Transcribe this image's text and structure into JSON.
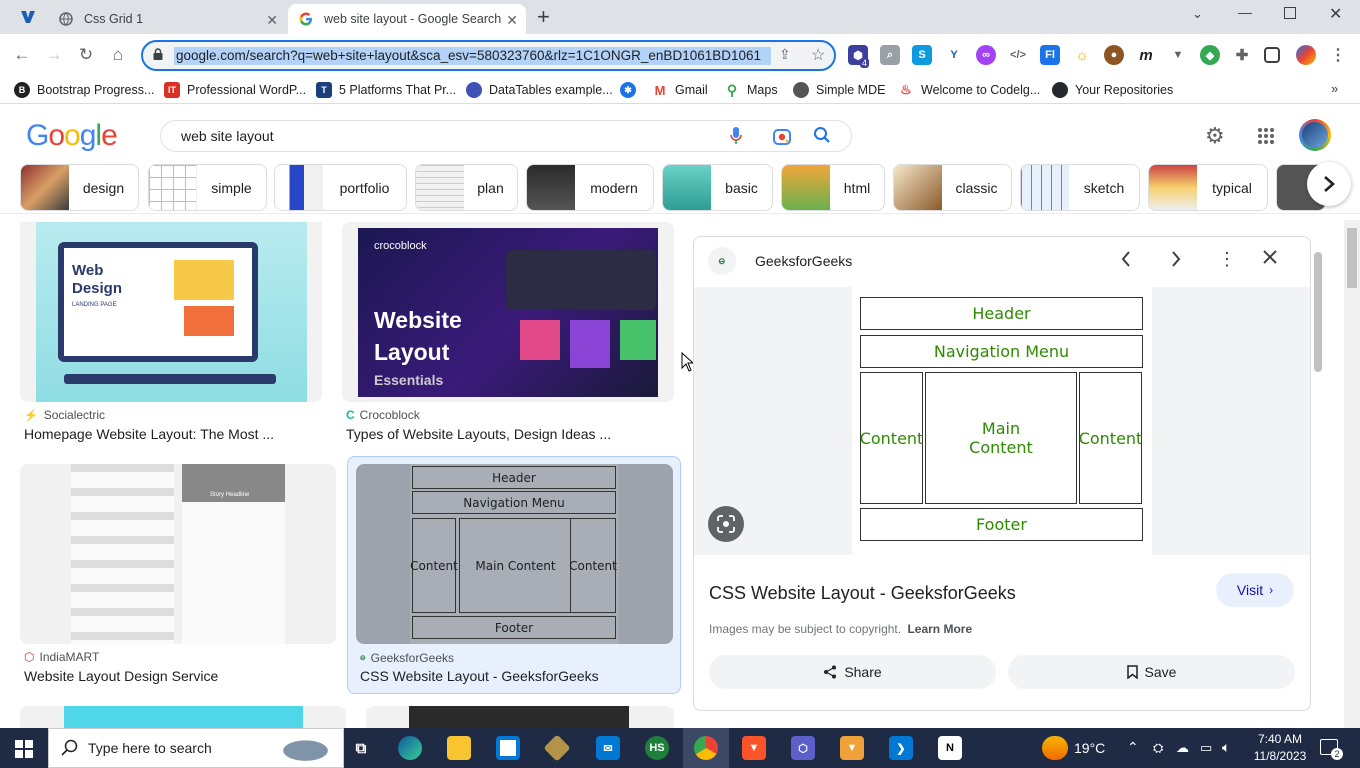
{
  "browser": {
    "tabs": [
      {
        "title": "Css Grid 1",
        "active": false
      },
      {
        "title": "web site layout - Google Search",
        "active": true
      }
    ],
    "new_tab": "+",
    "url": "google.com/search?q=web+site+layout&sca_esv=580323760&rlz=1C1ONGR_enBD1061BD1061",
    "window_controls": [
      "chevron-down-icon",
      "minimize-icon",
      "restore-icon",
      "close-icon"
    ],
    "extension_badge": "4"
  },
  "bookmarks": [
    {
      "label": "Bootstrap Progress...",
      "icon_color": "#222222",
      "glyph": "B"
    },
    {
      "label": "Professional WordP...",
      "icon_color": "#d93025",
      "glyph": "IT"
    },
    {
      "label": "5 Platforms That Pr...",
      "icon_color": "#1a3f7a",
      "glyph": "T"
    },
    {
      "label": "DataTables example...",
      "icon_color": "#3f51b5",
      "glyph": ""
    },
    {
      "label": "",
      "icon_color": "#1a73e8",
      "glyph": ""
    },
    {
      "label": "Gmail",
      "icon_color": "#ea4335",
      "glyph": "M"
    },
    {
      "label": "Maps",
      "icon_color": "#34a853",
      "glyph": ""
    },
    {
      "label": "Simple MDE",
      "icon_color": "#555555",
      "glyph": ""
    },
    {
      "label": "Welcome to Codelg...",
      "icon_color": "#e8453c",
      "glyph": ""
    },
    {
      "label": "Your Repositories",
      "icon_color": "#24292f",
      "glyph": ""
    }
  ],
  "search": {
    "query": "web site layout",
    "logo_letters": [
      {
        "ch": "G",
        "color": "#4285f4"
      },
      {
        "ch": "o",
        "color": "#ea4335"
      },
      {
        "ch": "o",
        "color": "#fbbc05"
      },
      {
        "ch": "g",
        "color": "#4285f4"
      },
      {
        "ch": "l",
        "color": "#34a853"
      },
      {
        "ch": "e",
        "color": "#ea4335"
      }
    ]
  },
  "chips": [
    "design",
    "simple",
    "portfolio",
    "plan",
    "modern",
    "basic",
    "html",
    "classic",
    "sketch",
    "typical"
  ],
  "results": [
    {
      "source": "Socialectric",
      "title": "Homepage Website Layout: The Most ...",
      "img_text": "Web Design",
      "img_sub": "LANDING PAGE"
    },
    {
      "source": "Crocoblock",
      "title": "Types of Website Layouts, Design Ideas ...",
      "img_brand": "crocoblock",
      "img_text": "Website Layout",
      "img_sub": "Essentials"
    },
    {
      "source": "IndiaMART",
      "title": "Website Layout Design Service",
      "img_sub": "Story Headline"
    },
    {
      "source": "GeeksforGeeks",
      "title": "CSS Website Layout - GeeksforGeeks"
    }
  ],
  "layout_diagram": {
    "header": "Header",
    "nav": "Navigation Menu",
    "content_left": "Content",
    "main": "Main Content",
    "content_right": "Content",
    "footer": "Footer"
  },
  "panel": {
    "source": "GeeksforGeeks",
    "title": "CSS Website Layout - GeeksforGeeks",
    "visit": "Visit",
    "copyright": "Images may be subject to copyright.",
    "learn_more": "Learn More",
    "share": "Share",
    "save": "Save"
  },
  "taskbar": {
    "search_placeholder": "Type here to search",
    "weather": "19°C",
    "time": "7:40 AM",
    "date": "11/8/2023",
    "notification_count": "2",
    "app_label": "HS"
  },
  "colors": {
    "accent": "#1a73e8",
    "diagram_text": "#2e8b00",
    "taskbar": "#1f2a44"
  }
}
